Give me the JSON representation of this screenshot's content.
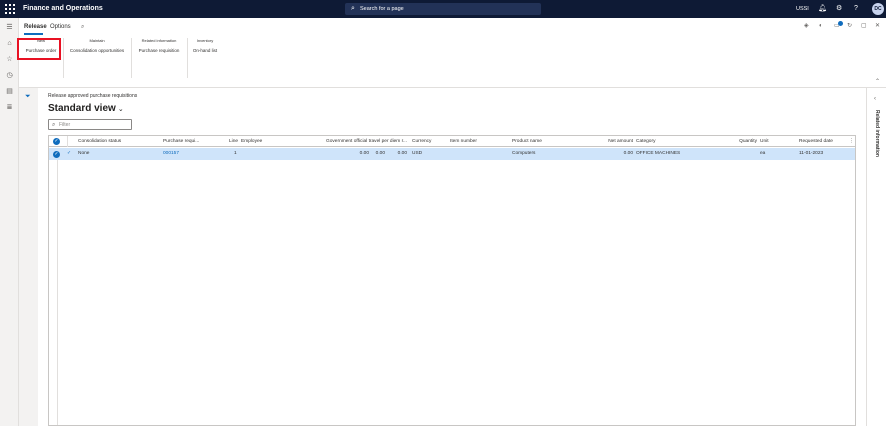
{
  "topbar": {
    "app_title": "Finance and Operations",
    "search_placeholder": "Search for a page",
    "company": "USSI",
    "avatar_initials": "DC"
  },
  "tabs": [
    {
      "label": "Release",
      "active": true
    },
    {
      "label": "Options",
      "active": false
    }
  ],
  "groups": [
    {
      "title": "New",
      "button": "Purchase order"
    },
    {
      "title": "Maintain",
      "button": "Consolidation opportunities"
    },
    {
      "title": "Related information",
      "button": "Purchase requisition"
    },
    {
      "title": "Inventory",
      "button": "On-hand list"
    }
  ],
  "page": {
    "caption": "Release approved purchase requisitions",
    "view_title": "Standard view",
    "view_chevron": "⌄",
    "filter_placeholder": "Filter"
  },
  "grid": {
    "columns": {
      "status": "Consolidation status",
      "purchreq": "Purchase requi...",
      "line": "Line",
      "employee": "Employee",
      "govt": "Government official travel per diem r...",
      "currency": "Currency",
      "item": "Item number",
      "product": "Product name",
      "net": "Net amount",
      "category": "Category",
      "qty": "Quantity",
      "unit": "Unit",
      "reqdate": "Requested date"
    },
    "rows": [
      {
        "check": "✓",
        "status": "None",
        "purchreq": "000157",
        "line": "1",
        "employee": "",
        "govt_a": "0.00",
        "govt_b": "0.00",
        "govt_c": "0.00",
        "currency": "USD",
        "item": "",
        "product": "Computers",
        "net": "0.00",
        "category": "OFFICE MACHINES",
        "qty": "",
        "unit": "ea",
        "reqdate": "11-01-2023"
      }
    ],
    "more_icon": "⋮"
  },
  "related_panel": {
    "label": "Related information"
  },
  "colors": {
    "topbar": "#0e1a35",
    "accent": "#0f6cbd",
    "selected_row": "#cfe4fa",
    "highlight_box": "#e81123"
  }
}
